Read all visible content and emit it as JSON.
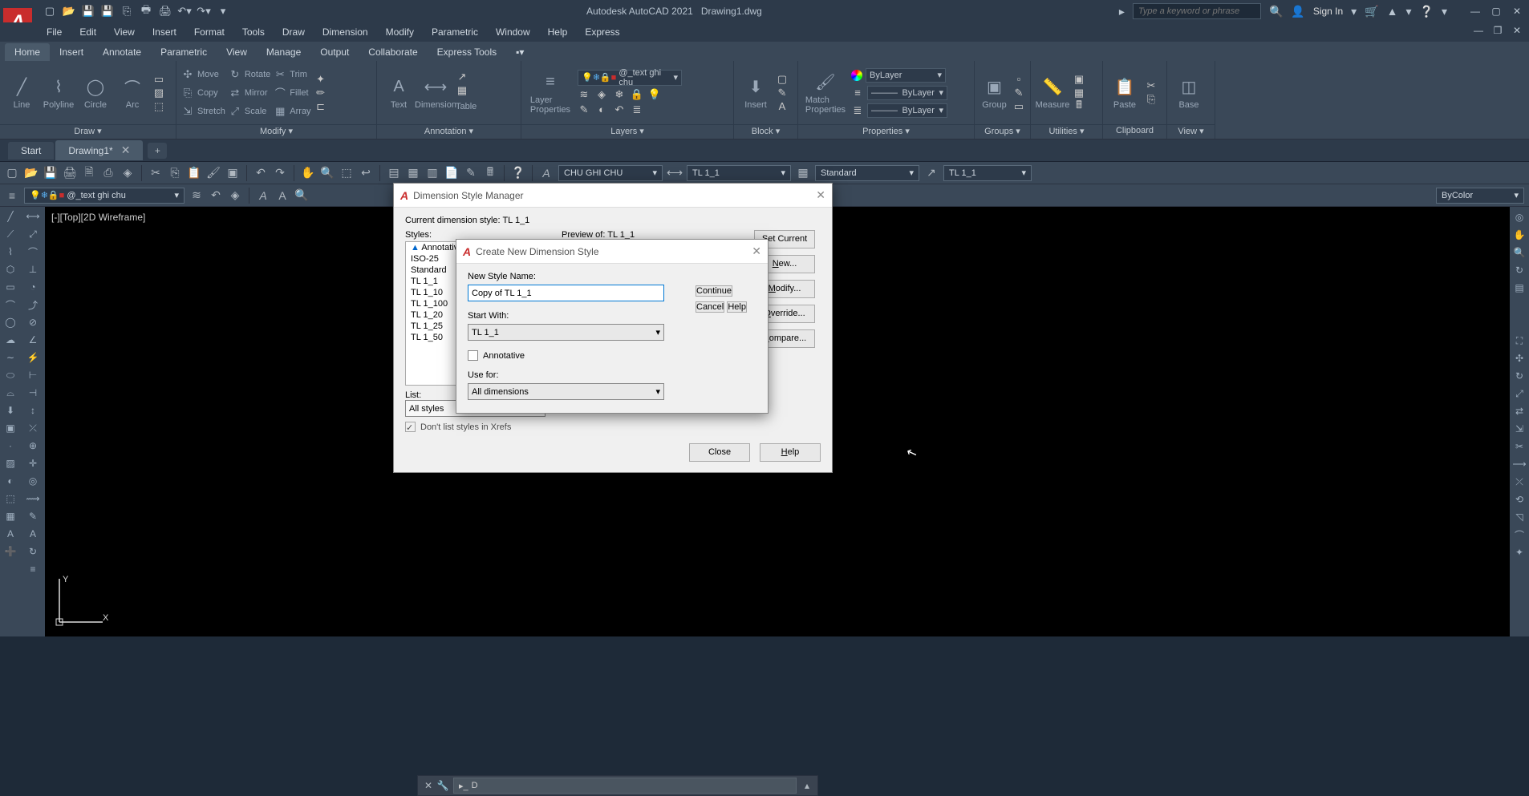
{
  "title": {
    "app": "Autodesk AutoCAD 2021",
    "doc": "Drawing1.dwg",
    "search_placeholder": "Type a keyword or phrase",
    "signin": "Sign In"
  },
  "menubar": [
    "File",
    "Edit",
    "View",
    "Insert",
    "Format",
    "Tools",
    "Draw",
    "Dimension",
    "Modify",
    "Parametric",
    "Window",
    "Help",
    "Express"
  ],
  "ribbon_tabs": [
    "Home",
    "Insert",
    "Annotate",
    "Parametric",
    "View",
    "Manage",
    "Output",
    "Collaborate",
    "Express Tools"
  ],
  "ribbon": {
    "draw": {
      "label": "Draw ▾",
      "line": "Line",
      "polyline": "Polyline",
      "circle": "Circle",
      "arc": "Arc"
    },
    "modify": {
      "label": "Modify ▾",
      "move": "Move",
      "rotate": "Rotate",
      "trim": "Trim",
      "copy": "Copy",
      "mirror": "Mirror",
      "fillet": "Fillet",
      "stretch": "Stretch",
      "scale": "Scale",
      "array": "Array"
    },
    "annotation": {
      "label": "Annotation ▾",
      "text": "Text",
      "dimension": "Dimension",
      "table": "Table"
    },
    "layers": {
      "label": "Layers ▾",
      "properties": "Layer\nProperties",
      "combo": "@_text ghi chu"
    },
    "block": {
      "label": "Block ▾",
      "insert": "Insert"
    },
    "properties": {
      "label": "Properties ▾",
      "match": "Match\nProperties",
      "bylayer": "ByLayer"
    },
    "groups": {
      "label": "Groups ▾",
      "group": "Group"
    },
    "utilities": {
      "label": "Utilities ▾",
      "measure": "Measure"
    },
    "clipboard": {
      "label": "Clipboard",
      "paste": "Paste"
    },
    "view": {
      "label": "View ▾",
      "base": "Base"
    }
  },
  "filetabs": {
    "start": "Start",
    "drawing": "Drawing1*"
  },
  "toolbar2": {
    "layer_combo": "@_text ghi chu",
    "style1": "CHU GHI CHU",
    "style2": "TL 1_1",
    "style3": "Standard",
    "style4": "TL 1_1",
    "color": "ByColor"
  },
  "viewport": "[-][Top][2D Wireframe]",
  "ucs": {
    "y": "Y",
    "x": "X"
  },
  "dsm_dialog": {
    "title": "Dimension Style Manager",
    "current_label": "Current dimension style: TL 1_1",
    "styles_label": "Styles:",
    "preview_label": "Preview of: TL 1_1",
    "styles": [
      "Annotativ",
      "ISO-25",
      "Standard",
      "TL 1_1",
      "TL 1_10",
      "TL 1_100",
      "TL 1_20",
      "TL 1_25",
      "TL 1_50"
    ],
    "list_label": "List:",
    "list_value": "All styles",
    "xref_label": "Don't list styles in Xrefs",
    "btn_setcurrent": "Set Current",
    "btn_new": "New...",
    "btn_modify": "Modify...",
    "btn_override": "Override...",
    "btn_compare": "Compare...",
    "btn_close": "Close",
    "btn_help": "Help"
  },
  "new_dialog": {
    "title": "Create New Dimension Style",
    "name_label": "New Style Name:",
    "name_value": "Copy of TL 1_1",
    "start_label": "Start With:",
    "start_value": "TL 1_1",
    "annotative_label": "Annotative",
    "usefor_label": "Use for:",
    "usefor_value": "All dimensions",
    "btn_continue": "Continue",
    "btn_cancel": "Cancel",
    "btn_help": "Help"
  },
  "cmdline": {
    "prompt": "D"
  }
}
